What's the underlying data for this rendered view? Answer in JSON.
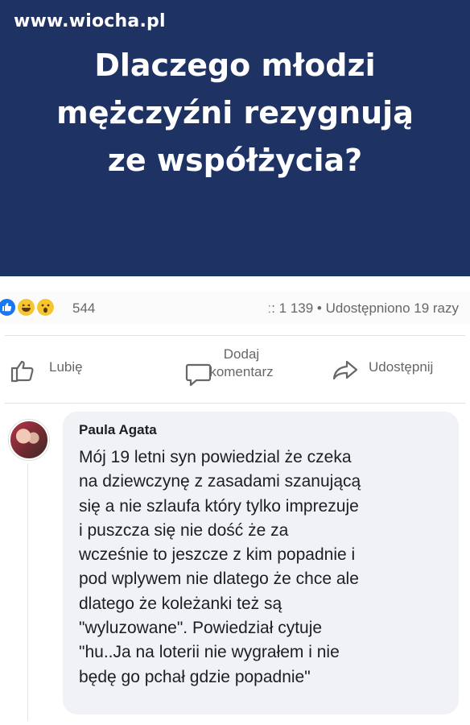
{
  "watermark": "www.wiocha.pl",
  "headline": {
    "lines": [
      "Dlaczego młodzi",
      "mężczyźni rezygnują",
      "ze współżycia?"
    ]
  },
  "colors": {
    "banner": "#1e3263",
    "muted_text": "#65676b",
    "comment_bubble": "#f0f2f5",
    "like_blue": "#1877f2",
    "emoji_yellow": "#f7c62f"
  },
  "stats": {
    "reaction_icons": [
      "like-icon",
      "haha-emoji-icon",
      "wow-emoji-icon"
    ],
    "reaction_count": "544",
    "comments_shares": "ː: 1 139 • Udostępniono 19 razy"
  },
  "actions": {
    "like": "Lubię",
    "comment_line1": "Dodaj",
    "comment_line2": "komentarz",
    "share": "Udostępnij"
  },
  "comment": {
    "author": "Paula Agata",
    "lines": [
      "Mój 19 letni syn powiedzial że czeka",
      "na dziewczynę z zasadami szanującą",
      "się a nie szlaufa który tylko imprezuje",
      "i puszcza się nie dość że za",
      "wcześnie to jeszcze z kim popadnie i",
      "pod wplywem nie dlatego że chce ale",
      "dlatego że koleżanki też są",
      "\"wyluzowane\". Powiedział cytuje",
      "\"hu..Ja  na loterii nie wygrałem i nie",
      "będę go pchał gdzie popadnie\""
    ]
  }
}
